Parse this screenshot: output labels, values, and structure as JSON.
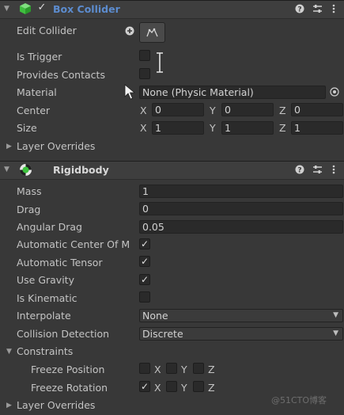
{
  "box_collider": {
    "title": "Box Collider",
    "enabled": true,
    "edit_collider_label": "Edit Collider",
    "is_trigger_label": "Is Trigger",
    "is_trigger": false,
    "provides_contacts_label": "Provides Contacts",
    "provides_contacts": false,
    "material_label": "Material",
    "material_value": "None (Physic Material)",
    "center_label": "Center",
    "center": {
      "x": "0",
      "y": "0",
      "z": "0"
    },
    "size_label": "Size",
    "size": {
      "x": "1",
      "y": "1",
      "z": "1"
    },
    "layer_overrides_label": "Layer Overrides",
    "axes": {
      "x": "X",
      "y": "Y",
      "z": "Z"
    }
  },
  "rigidbody": {
    "title": "Rigidbody",
    "mass_label": "Mass",
    "mass": "1",
    "drag_label": "Drag",
    "drag": "0",
    "angular_drag_label": "Angular Drag",
    "angular_drag": "0.05",
    "auto_center_label": "Automatic Center Of M",
    "auto_center": true,
    "auto_tensor_label": "Automatic Tensor",
    "auto_tensor": true,
    "use_gravity_label": "Use Gravity",
    "use_gravity": true,
    "is_kinematic_label": "Is Kinematic",
    "is_kinematic": false,
    "interpolate_label": "Interpolate",
    "interpolate_value": "None",
    "collision_label": "Collision Detection",
    "collision_value": "Discrete",
    "constraints_label": "Constraints",
    "freeze_position_label": "Freeze Position",
    "freeze_rotation_label": "Freeze Rotation",
    "freeze_position": {
      "x": false,
      "y": false,
      "z": false
    },
    "freeze_rotation": {
      "x": true,
      "y": false,
      "z": false
    },
    "layer_overrides_label": "Layer Overrides",
    "axes": {
      "x": "X",
      "y": "Y",
      "z": "Z"
    }
  },
  "watermark": "@51CTO博客",
  "colors": {
    "header_title_selected": "#5c8ccf",
    "cube_icon": "#4bd34b",
    "panel_bg": "#383838",
    "field_bg": "#2a2a2a"
  },
  "icons": [
    "fold-arrow-icon",
    "cube-icon",
    "help-icon",
    "presets-icon",
    "more-menu-icon",
    "plus-icon",
    "edit-collider-icon",
    "object-picker-icon",
    "rigidbody-icon",
    "dropdown-arrow-icon"
  ]
}
